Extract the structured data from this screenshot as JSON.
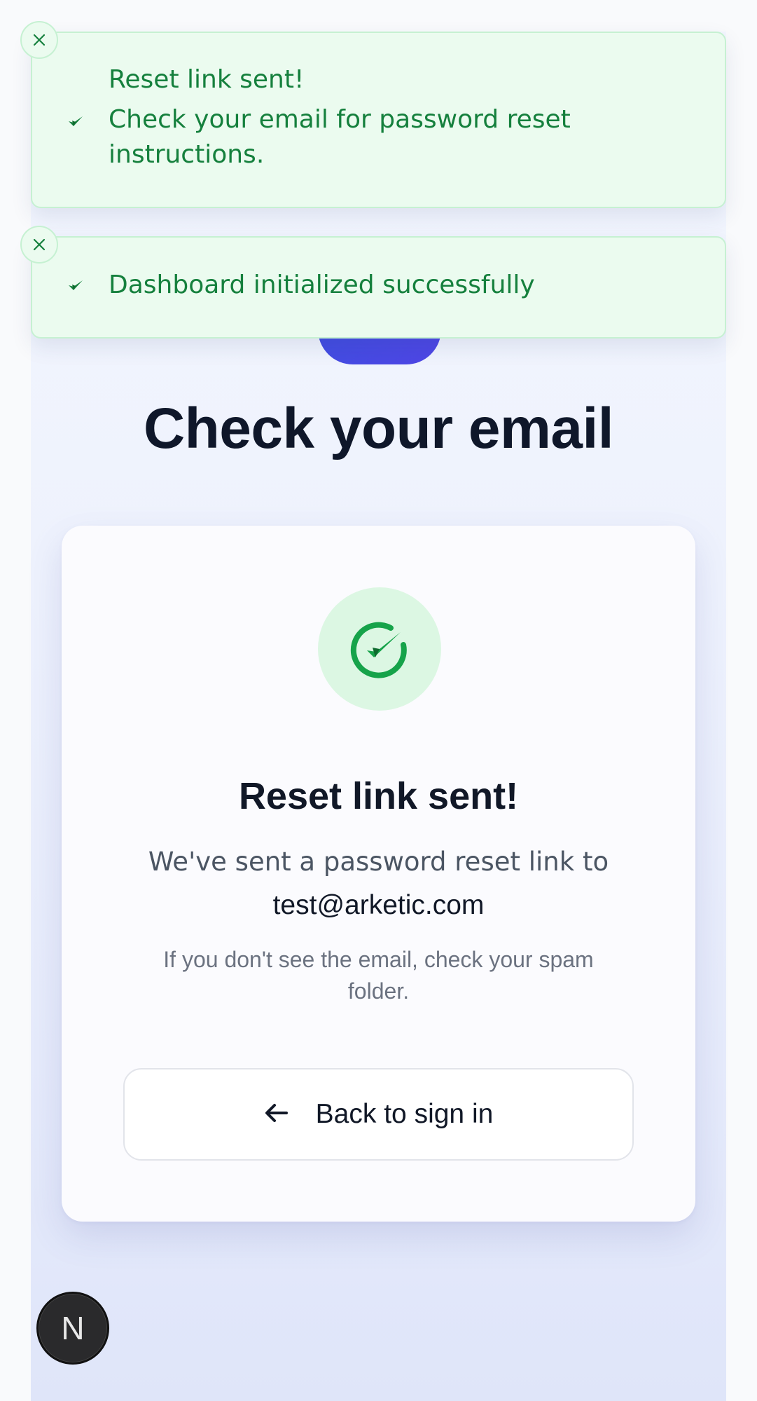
{
  "page": {
    "title": "Check your email"
  },
  "card": {
    "title": "Reset link sent!",
    "description": "We've sent a password reset link to",
    "email": "test@arketic.com",
    "hint": "If you don't see the email, check your spam folder.",
    "back_button_label": "Back to sign in",
    "success_icon": "check-circle-icon",
    "back_icon": "arrow-left-icon"
  },
  "toasts": [
    {
      "title": "Reset link sent!",
      "description": "Check your email for password reset instructions.",
      "icon": "check-icon",
      "close_icon": "close-icon"
    },
    {
      "title": "Dashboard initialized successfully",
      "icon": "check-icon",
      "close_icon": "close-icon"
    }
  ],
  "dev_badge": {
    "label": "N"
  },
  "colors": {
    "accent": "#4f46e5",
    "success": "#16a34a",
    "toast_bg": "#ebfbef",
    "title": "#0f172a"
  }
}
